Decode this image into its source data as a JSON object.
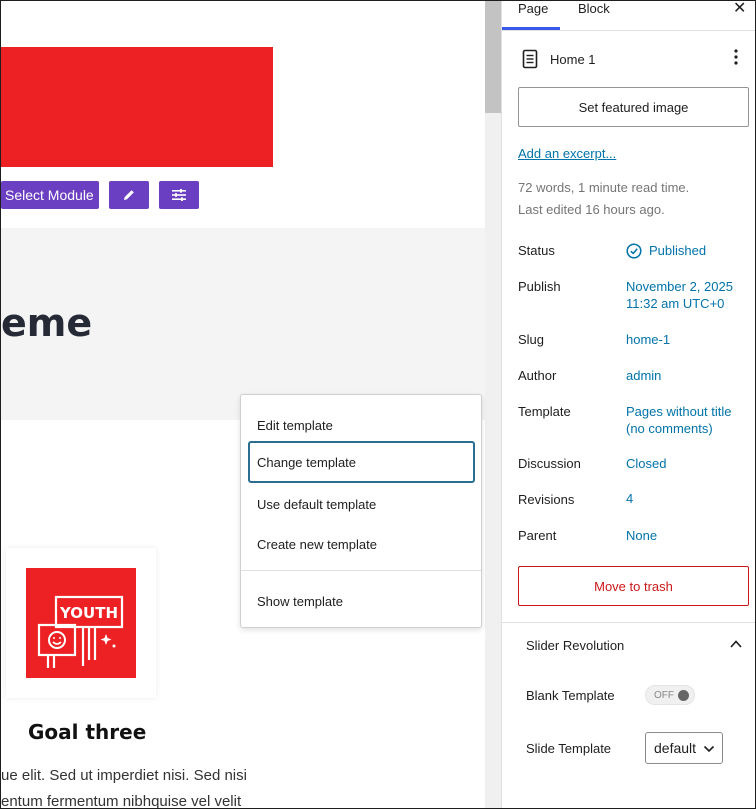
{
  "canvas": {
    "module_toolbar": {
      "select_label": "Select Module",
      "edit_icon": "pencil-icon",
      "settings_icon": "sliders-icon"
    },
    "heading_fragment": "eme",
    "goal": {
      "logo_text": "YOUTH",
      "title": "Goal three"
    },
    "body_lines": [
      "ue elit. Sed ut imperdiet nisi. Sed nisi",
      "entum fermentum nibhquise vel velit"
    ]
  },
  "template_menu": {
    "items": [
      "Edit template",
      "Change template",
      "Use default template",
      "Create new template"
    ],
    "footer_item": "Show template",
    "active_index": 1
  },
  "sidebar": {
    "tabs": [
      "Page",
      "Block"
    ],
    "active_tab": "Page",
    "close_icon": "close-icon",
    "document": {
      "icon": "page-icon",
      "title": "Home 1",
      "menu_icon": "more-vertical-icon"
    },
    "featured_image_label": "Set featured image",
    "excerpt_link": "Add an excerpt...",
    "stats": "72 words, 1 minute read time.",
    "last_edited": "Last edited 16 hours ago.",
    "fields": [
      {
        "label": "Status",
        "value": "Published"
      },
      {
        "label": "Publish",
        "value": "November 2, 2025",
        "value2": "11:32 am UTC+0"
      },
      {
        "label": "Slug",
        "value": "home-1"
      },
      {
        "label": "Author",
        "value": "admin"
      },
      {
        "label": "Template",
        "value": "Pages without title",
        "value2": "(no comments)"
      },
      {
        "label": "Discussion",
        "value": "Closed"
      },
      {
        "label": "Revisions",
        "value": "4"
      },
      {
        "label": "Parent",
        "value": "None"
      }
    ],
    "trash_label": "Move to trash",
    "slider_panel": {
      "title": "Slider Revolution",
      "blank_template_label": "Blank Template",
      "toggle_state": "OFF",
      "slide_template_label": "Slide Template",
      "slide_template_value": "default"
    }
  },
  "colors": {
    "accent": "#3858e9",
    "link": "#0073aa",
    "danger": "#cc1818",
    "module_purple": "#6b3fc1",
    "brand_red": "#ed2124"
  }
}
